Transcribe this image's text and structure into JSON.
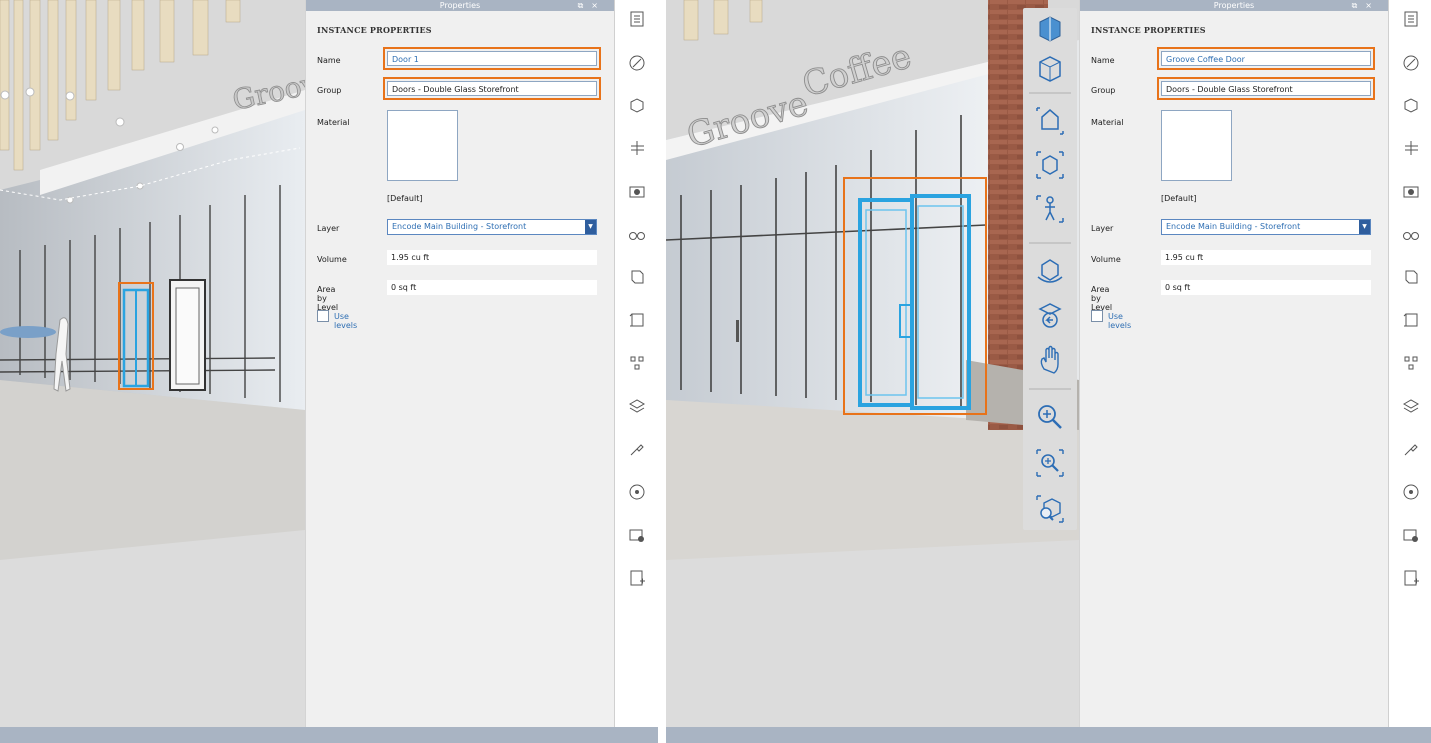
{
  "panels": [
    {
      "title": "Properties",
      "heading": "INSTANCE PROPERTIES",
      "fields": {
        "name": {
          "label": "Name",
          "value": "Door 1"
        },
        "group": {
          "label": "Group",
          "value": "Doors - Double Glass Storefront"
        },
        "material": {
          "label": "Material",
          "value": "[Default]"
        },
        "layer": {
          "label": "Layer",
          "value": "Encode Main Building - Storefront"
        },
        "volume": {
          "label": "Volume",
          "value": "1.95 cu ft"
        },
        "area": {
          "label": "Area by Level",
          "value": "0 sq ft"
        },
        "use_levels": {
          "label": "Use levels",
          "checked": false
        }
      }
    },
    {
      "title": "Properties",
      "heading": "INSTANCE PROPERTIES",
      "fields": {
        "name": {
          "label": "Name",
          "value": "Groove Coffee Door"
        },
        "group": {
          "label": "Group",
          "value": "Doors - Double Glass Storefront"
        },
        "material": {
          "label": "Material",
          "value": "[Default]"
        },
        "layer": {
          "label": "Layer",
          "value": "Encode Main Building - Storefront"
        },
        "volume": {
          "label": "Volume",
          "value": "1.95 cu ft"
        },
        "area": {
          "label": "Area by Level",
          "value": "0 sq ft"
        },
        "use_levels": {
          "label": "Use levels",
          "checked": false
        }
      }
    }
  ],
  "scene": {
    "left_sign_text": "Groov",
    "right_sign_text_1": "Groove",
    "right_sign_text_2": "Coffee"
  },
  "colors": {
    "accent": "#e8731a",
    "selection": "#2aa3e0",
    "panel_bg": "#f0f0f0",
    "titlebar": "#a9b4c3",
    "link": "#2f6fb3"
  },
  "side_rail_icons": [
    "properties-icon",
    "style-icon",
    "view-cube-icon",
    "section-icon",
    "camera-icon",
    "glasses-icon",
    "model-icon",
    "storey-icon",
    "hierarchy-icon",
    "layers-icon",
    "plugin-icon",
    "visualize-icon",
    "settings-camera-icon",
    "export-icon"
  ],
  "nav_bar_icons": [
    "viewcube-icon",
    "perspective-icon",
    "home-icon",
    "fit-icon",
    "walk-icon",
    "orbit-icon",
    "look-icon",
    "pan-icon",
    "zoom-icon",
    "zoom-window-icon",
    "zoom-selection-icon"
  ]
}
